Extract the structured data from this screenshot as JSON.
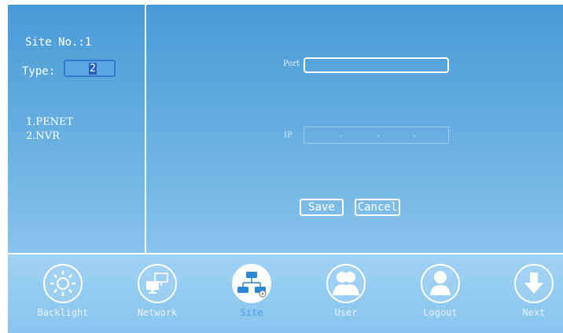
{
  "site": {
    "site_no_text": "Site No.:1",
    "type_label": "Type:",
    "type_value": "2",
    "options": [
      "1.PENET",
      "2.NVR"
    ]
  },
  "form": {
    "port_label": "Port",
    "port_value": "",
    "ip_label": "IP",
    "ip_dots": [
      ".",
      ".",
      "."
    ],
    "save_label": "Save",
    "cancel_label": "Cancel"
  },
  "toolbar": {
    "items": [
      {
        "label": "Backlight",
        "icon": "sun-icon",
        "active": false
      },
      {
        "label": "Network",
        "icon": "network-icon",
        "active": false
      },
      {
        "label": "Site",
        "icon": "site-tree-icon",
        "active": true
      },
      {
        "label": "User",
        "icon": "users-icon",
        "active": false
      },
      {
        "label": "Logout",
        "icon": "user-icon",
        "active": false
      },
      {
        "label": "Next",
        "icon": "arrow-down-icon",
        "active": false
      }
    ]
  },
  "colors": {
    "panel_top": "#4a9ad8",
    "panel_bottom": "#88c3ec",
    "toolbar_bg": "#9fd2f4",
    "accent": "#4aa0e8",
    "type_input_border": "#2f7ccf"
  }
}
